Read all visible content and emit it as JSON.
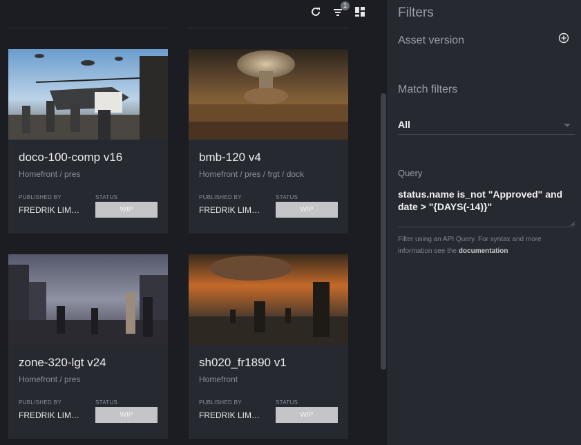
{
  "toolbar": {
    "refresh_icon": "refresh-icon",
    "filter_icon": "filter-icon",
    "filter_badge": "1",
    "layout_icon": "grid-layout-icon"
  },
  "cards": [
    {
      "title": "doco-100-comp v16",
      "path": "Homefront / pres",
      "published_label": "PUBLISHED BY",
      "publisher": "FREDRIK LIM…",
      "status_label": "STATUS",
      "status": "WIP"
    },
    {
      "title": "bmb-120 v4",
      "path": "Homefront / pres / frgt / dock",
      "published_label": "PUBLISHED BY",
      "publisher": "FREDRIK LIM…",
      "status_label": "STATUS",
      "status": "WIP"
    },
    {
      "title": "zone-320-lgt v24",
      "path": "Homefront / pres",
      "published_label": "PUBLISHED BY",
      "publisher": "FREDRIK LIM…",
      "status_label": "STATUS",
      "status": "WIP"
    },
    {
      "title": "sh020_fr1890 v1",
      "path": "Homefront",
      "published_label": "PUBLISHED BY",
      "publisher": "FREDRIK LIM…",
      "status_label": "STATUS",
      "status": "WIP"
    }
  ],
  "filters": {
    "title": "Filters",
    "asset_version_label": "Asset version",
    "add_icon": "add-circle-icon",
    "match_filters_label": "Match filters",
    "match_value": "All",
    "query_label": "Query",
    "query_value": "status.name is_not \"Approved\" and date > \"{DAYS(-14)}\"",
    "help_prefix": "Filter using an API Query. For syntax and more information see the ",
    "help_link": "documentation"
  },
  "colors": {
    "background": "#1b1d22",
    "card": "#262930",
    "status_wip": "#c3c5c9"
  }
}
